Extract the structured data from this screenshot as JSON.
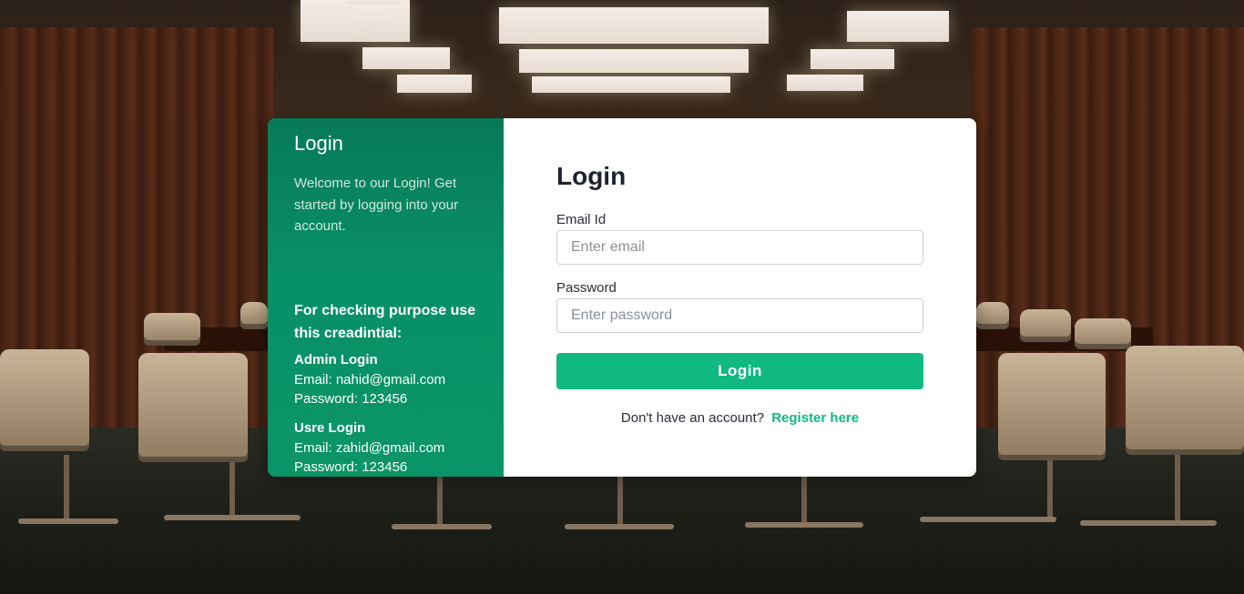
{
  "left_panel": {
    "title": "Login",
    "welcome": "Welcome to our Login! Get started by logging into your account.",
    "cred_heading": "For checking purpose use this creadintial:",
    "admin": {
      "title": "Admin Login",
      "email": "Email: nahid@gmail.com",
      "password": "Password: 123456"
    },
    "user": {
      "title": "Usre Login",
      "email": "Email: zahid@gmail.com",
      "password": "Password: 123456"
    }
  },
  "form": {
    "title": "Login",
    "email_label": "Email Id",
    "email_placeholder": "Enter email",
    "email_value": "",
    "password_label": "Password",
    "password_placeholder": "Enter password",
    "password_value": "",
    "submit_label": "Login",
    "register_prompt": "Don't have an account?",
    "register_link": "Register here"
  },
  "colors": {
    "accent": "#10b981",
    "panel_green": "#089066",
    "heading": "#1f2230"
  }
}
